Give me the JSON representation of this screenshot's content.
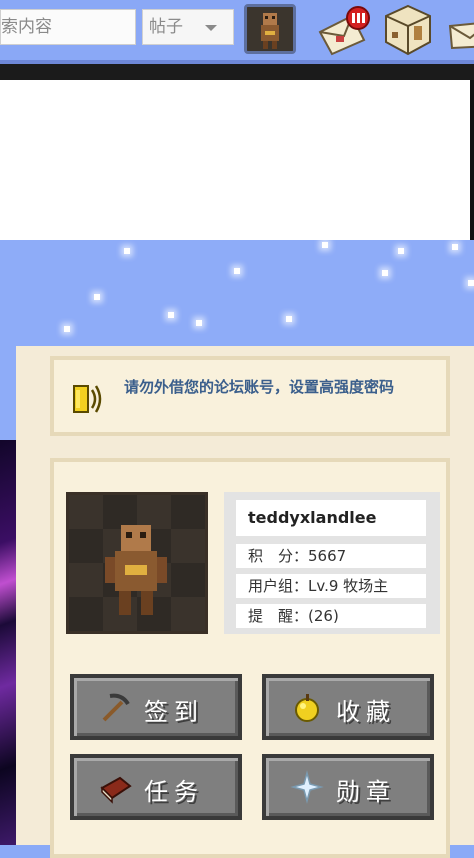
{
  "header": {
    "search_placeholder": "索内容",
    "search_type": "帖子"
  },
  "notice": {
    "text": "请勿外借您的论坛账号，设置高强度密码"
  },
  "profile": {
    "username": "teddyxlandlee",
    "points_label": "积　分：",
    "points_value": "5667",
    "group_label": "用户组：",
    "group_value": "Lv.9 牧场主",
    "reminder_label": "提　醒：",
    "reminder_value": "(26)"
  },
  "actions": {
    "signin": "签到",
    "favorites": "收藏",
    "tasks": "任务",
    "medals": "勋章"
  },
  "icons": {
    "messages": "envelope-icon",
    "notifications": "package-icon",
    "more": "envelope-icon"
  },
  "colors": {
    "sky": "#8eacf8",
    "cream": "#f4ebd7",
    "notice_text": "#3b5f8c"
  }
}
